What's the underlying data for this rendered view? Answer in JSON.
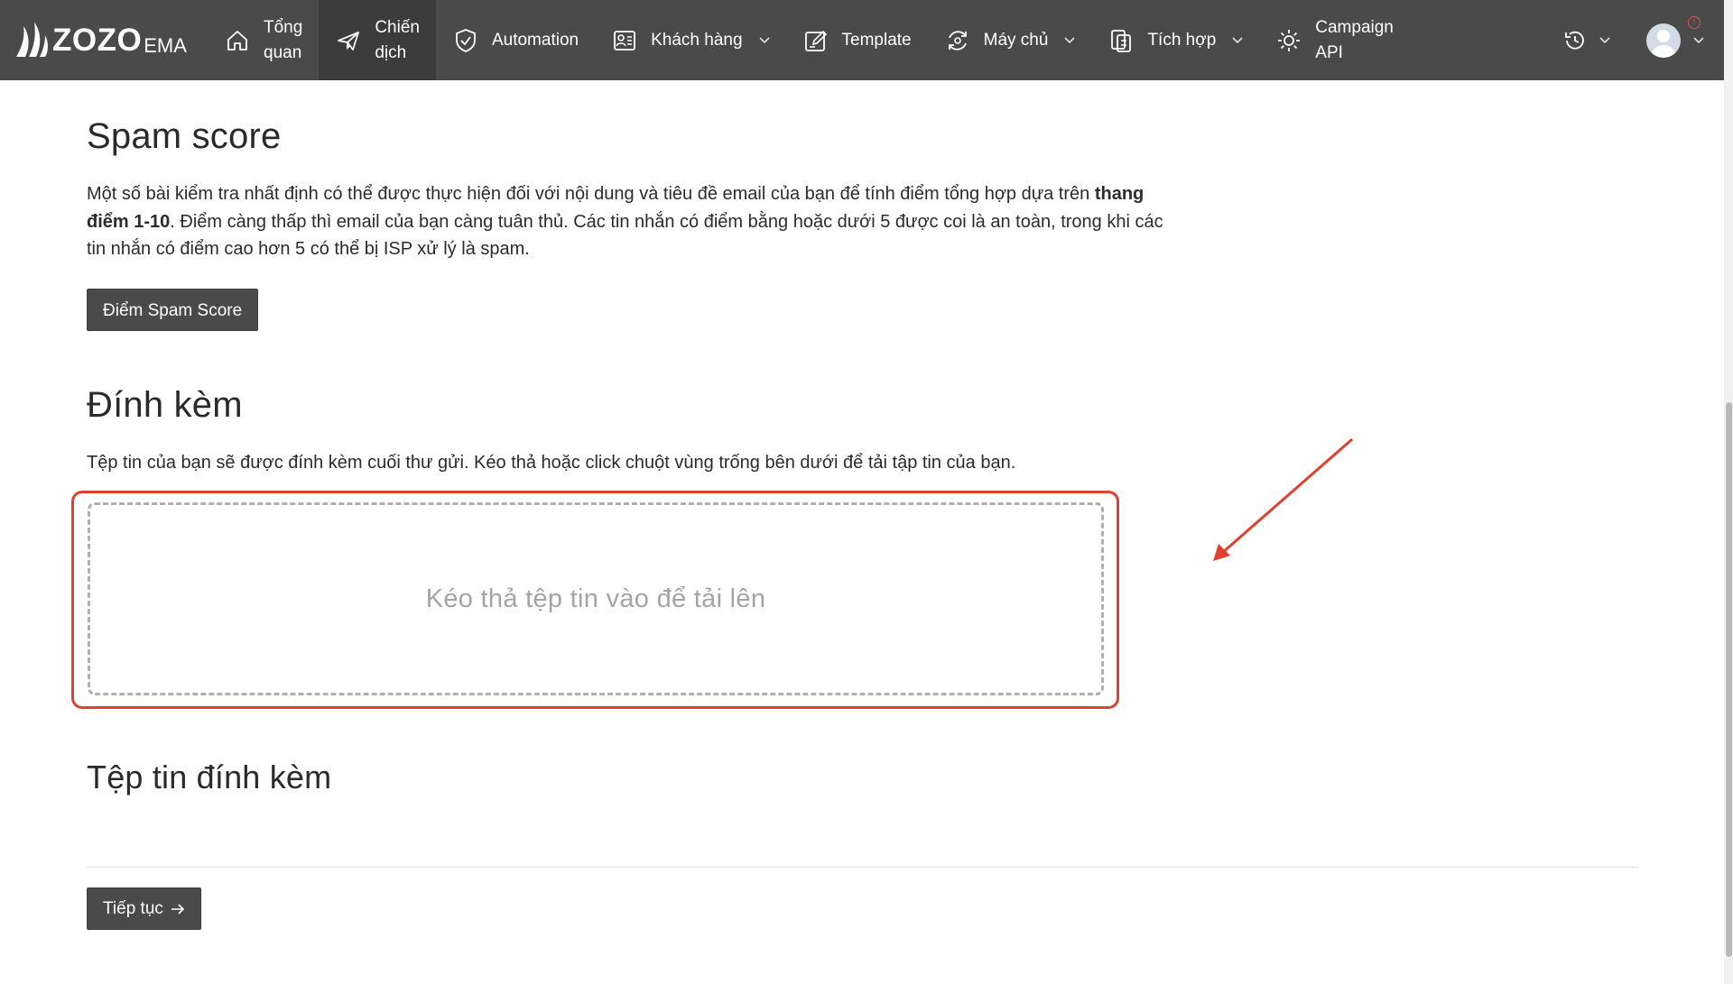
{
  "brand": {
    "name": "ZOZO",
    "suffix": "EMA"
  },
  "nav": {
    "items": [
      {
        "label": "Tổng\nquan",
        "icon": "home-icon",
        "dropdown": false
      },
      {
        "label": "Chiến\ndịch",
        "icon": "paper-plane-icon",
        "dropdown": false
      },
      {
        "label": "Automation",
        "icon": "check-badge-icon",
        "dropdown": false
      },
      {
        "label": "Khách hàng",
        "icon": "contact-list-icon",
        "dropdown": true
      },
      {
        "label": "Template",
        "icon": "edit-template-icon",
        "dropdown": false
      },
      {
        "label": "Máy chủ",
        "icon": "server-sync-icon",
        "dropdown": true
      },
      {
        "label": "Tích hợp",
        "icon": "integration-icon",
        "dropdown": true
      },
      {
        "label": "Campaign\nAPI",
        "icon": "gear-api-icon",
        "dropdown": false
      }
    ],
    "right": {
      "history_icon": "history-icon",
      "avatar_icon": "user-avatar-icon",
      "alert_icon": "info-alert-icon",
      "alert_glyph": "!"
    }
  },
  "spam": {
    "title": "Spam score",
    "desc_prefix": "Một số bài kiểm tra nhất định có thể được thực hiện đối với nội dung và tiêu đề email của bạn để tính điểm tổng hợp dựa trên ",
    "desc_bold": "thang điểm 1-10",
    "desc_suffix": ". Điểm càng thấp thì email của bạn càng tuân thủ. Các tin nhắn có điểm bằng hoặc dưới 5 được coi là an toàn, trong khi các tin nhắn có điểm cao hơn 5 có thể bị ISP xử lý là spam.",
    "button_label": "Điểm Spam Score"
  },
  "attach": {
    "title": "Đính kèm",
    "desc": "Tệp tin của bạn sẽ được đính kèm cuối thư gửi. Kéo thả hoặc click chuột vùng trống bên dưới để tải tập tin của bạn.",
    "dropzone_text": "Kéo thả tệp tin vào để tải lên"
  },
  "files": {
    "title": "Tệp tin đính kèm"
  },
  "footer": {
    "continue_label": "Tiếp tục",
    "continue_icon": "arrow-right-icon"
  },
  "colors": {
    "nav_bg": "#4a4a4a",
    "button_bg": "#4a4a4a",
    "highlight": "#e0412f",
    "dropzone_border": "#b0b0b0"
  }
}
